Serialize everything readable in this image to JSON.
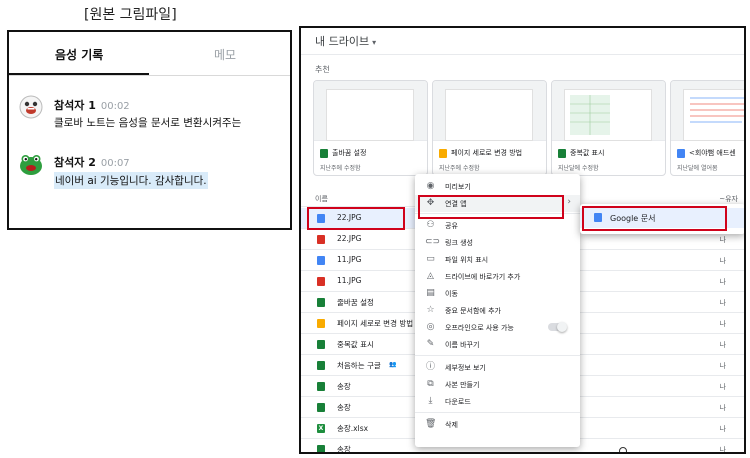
{
  "caption": "[원본 그림파일]",
  "note_app": {
    "tabs": [
      {
        "label": "음성 기록",
        "active": true
      },
      {
        "label": "메모",
        "active": false
      }
    ],
    "messages": [
      {
        "speaker": "참석자 1",
        "time": "00:02",
        "text": "클로바 노트는 음성을 문서로 변환시켜주는",
        "avatar": "brown-character-icon",
        "highlighted": false
      },
      {
        "speaker": "참석자 2",
        "time": "00:07",
        "text": "네이버 ai 기능입니다. 감사합니다.",
        "avatar": "green-frog-icon",
        "highlighted": true
      }
    ]
  },
  "drive": {
    "title": "내 드라이브",
    "suggested_label": "추천",
    "cards": [
      {
        "title": "출바꿈 설정",
        "subtitle": "지난주에 수정함",
        "icon": "sheets-icon"
      },
      {
        "title": "페이지 세로로 변경 방법",
        "subtitle": "지난주에 수정함",
        "icon": "slides-icon"
      },
      {
        "title": "중복값 표시",
        "subtitle": "지난달에 수정함",
        "icon": "sheets-icon"
      },
      {
        "title": "<회야뻠 애드센",
        "subtitle": "지난달에 열어봄",
        "icon": "docs-icon"
      }
    ],
    "list_header": {
      "name": "이름",
      "right": "~유자"
    },
    "rows": [
      {
        "name": "22.JPG",
        "icon": "docs-icon",
        "owner": "나",
        "selected": true
      },
      {
        "name": "22.JPG",
        "icon": "image-icon",
        "owner": "나",
        "selected": false
      },
      {
        "name": "11.JPG",
        "icon": "docs-icon",
        "owner": "나",
        "selected": false
      },
      {
        "name": "11.JPG",
        "icon": "image-icon",
        "owner": "나",
        "selected": false
      },
      {
        "name": "줄바꿈 설정",
        "icon": "sheets-icon",
        "owner": "나",
        "selected": false
      },
      {
        "name": "페이지 세로로 변경 방법",
        "icon": "slides-icon",
        "owner": "나",
        "selected": false
      },
      {
        "name": "중복값 표시",
        "icon": "sheets-icon",
        "owner": "나",
        "selected": false
      },
      {
        "name": "처음하는 구글",
        "icon": "sheets-icon",
        "owner": "나",
        "selected": false,
        "shared": true
      },
      {
        "name": "송장",
        "icon": "sheets-icon",
        "owner": "나",
        "selected": false
      },
      {
        "name": "송장",
        "icon": "sheets-icon",
        "owner": "나",
        "selected": false
      },
      {
        "name": "송장.xlsx",
        "icon": "excel-icon",
        "owner": "나",
        "selected": false
      },
      {
        "name": "송장",
        "icon": "sheets-icon",
        "owner": "나",
        "selected": false
      }
    ],
    "context_menu": [
      {
        "label": "미리보기",
        "icon": "eye-icon",
        "glyph": "◉"
      },
      {
        "label": "연결 앱",
        "icon": "move-arrows-icon",
        "glyph": "✥",
        "submenu": true,
        "hover": true
      },
      {
        "label": "공유",
        "icon": "add-person-icon",
        "glyph": "⚇"
      },
      {
        "label": "링크 생성",
        "icon": "link-icon",
        "glyph": "⊂⊃"
      },
      {
        "label": "파일 위치 표시",
        "icon": "folder-icon",
        "glyph": "▭"
      },
      {
        "label": "드라이브에 바로가기 추가",
        "icon": "drive-shortcut-icon",
        "glyph": "◬"
      },
      {
        "label": "이동",
        "icon": "move-folder-icon",
        "glyph": "▤"
      },
      {
        "label": "중요 문서함에 추가",
        "icon": "star-icon",
        "glyph": "☆"
      },
      {
        "label": "오프라인으로 사용 가능",
        "icon": "offline-icon",
        "glyph": "◎",
        "toggle": true
      },
      {
        "label": "이름 바꾸기",
        "icon": "pencil-icon",
        "glyph": "✎"
      },
      {
        "label": "세부정보 보기",
        "icon": "info-icon",
        "glyph": "ⓘ"
      },
      {
        "label": "사본 만들기",
        "icon": "copy-icon",
        "glyph": "⧉"
      },
      {
        "label": "다운로드",
        "icon": "download-icon",
        "glyph": "⤓"
      },
      {
        "label": "삭제",
        "icon": "trash-icon",
        "glyph": "🗑"
      }
    ],
    "submenu": {
      "label": "Google 문서",
      "icon": "docs-icon"
    }
  }
}
